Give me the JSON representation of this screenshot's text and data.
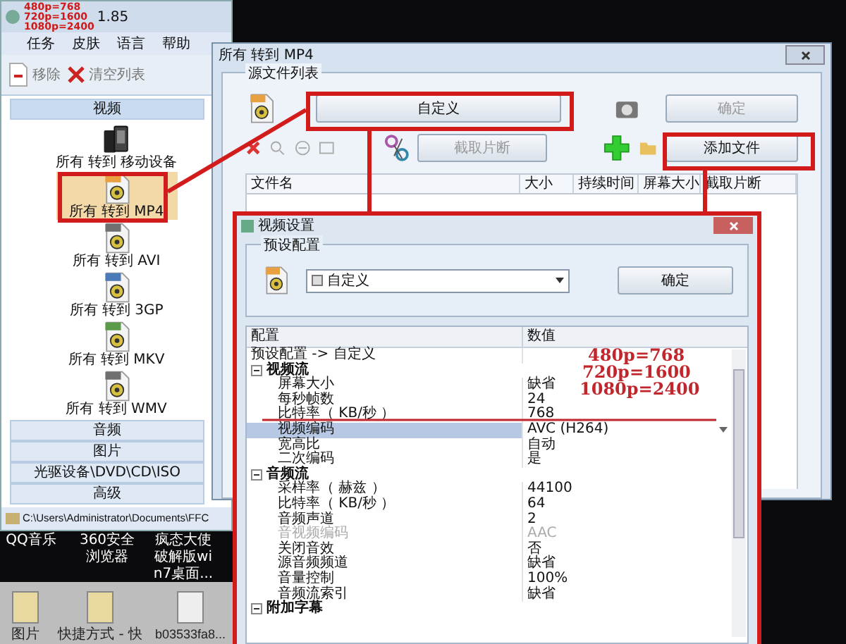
{
  "main_window": {
    "title": "1.85",
    "title_note": [
      "480p=768",
      "720p=1600",
      "1080p=2400"
    ],
    "menu": [
      "任务",
      "皮肤",
      "语言",
      "帮助"
    ],
    "toolbar": [
      "移除",
      "清空列表"
    ],
    "sections": [
      {
        "label": "视频",
        "expanded": true,
        "items": [
          {
            "label": "所有 转到 移动设备",
            "kind": "device",
            "selected": false
          },
          {
            "label": "所有 转到 MP4",
            "kind": "file",
            "color": "#e8a040",
            "selected": true
          },
          {
            "label": "所有 转到 AVI",
            "kind": "file",
            "color": "#707070",
            "selected": false
          },
          {
            "label": "所有 转到 3GP",
            "kind": "file",
            "color": "#4a7ab8",
            "selected": false
          },
          {
            "label": "所有 转到 MKV",
            "kind": "file",
            "color": "#5a9a48",
            "selected": false
          },
          {
            "label": "所有 转到 WMV",
            "kind": "file",
            "color": "#707070",
            "selected": false
          }
        ]
      },
      {
        "label": "音频",
        "expanded": false
      },
      {
        "label": "图片",
        "expanded": false
      },
      {
        "label": "光驱设备\\DVD\\CD\\ISO",
        "expanded": false
      },
      {
        "label": "高级",
        "expanded": false
      }
    ],
    "path": "C:\\Users\\Administrator\\Documents\\FFC"
  },
  "desktop": {
    "shortcuts": [
      {
        "label": "QQ音乐"
      },
      {
        "label": "360安全浏览器"
      },
      {
        "label": "疯态大使破解版win7桌面..."
      }
    ],
    "icons": [
      {
        "label": "图片"
      },
      {
        "label": "快捷方式 - 快"
      },
      {
        "label": "b03533fa8..."
      }
    ]
  },
  "convert_window": {
    "title": "所有 转到 MP4",
    "group": "源文件列表",
    "profile_button": "自定义",
    "ok_button": "确定",
    "clip_button": "截取片断",
    "add_button": "添加文件",
    "columns": [
      "文件名",
      "大小",
      "持续时间",
      "屏幕大小",
      "截取片断"
    ]
  },
  "video_settings": {
    "title": "视频设置",
    "group": "预设配置",
    "preset": "自定义",
    "ok_button": "确定",
    "columns": [
      "配置",
      "数值"
    ],
    "rows": [
      {
        "kind": "path",
        "label": "预设配置 -> 自定义"
      },
      {
        "kind": "category",
        "label": "视频流",
        "expanded": true
      },
      {
        "kind": "property",
        "label": "屏幕大小",
        "value": "缺省",
        "selected": false,
        "disabled": false
      },
      {
        "kind": "property",
        "label": "每秒帧数",
        "value": "24",
        "selected": false,
        "disabled": false
      },
      {
        "kind": "property",
        "label": "比特率（ KB/秒 ）",
        "value": "768",
        "selected": false,
        "disabled": false
      },
      {
        "kind": "property",
        "label": "视频编码",
        "value": "AVC (H264)",
        "selected": true,
        "disabled": false
      },
      {
        "kind": "property",
        "label": "宽高比",
        "value": "自动",
        "selected": false,
        "disabled": false
      },
      {
        "kind": "property",
        "label": "二次编码",
        "value": "是",
        "selected": false,
        "disabled": false
      },
      {
        "kind": "category",
        "label": "音频流",
        "expanded": true
      },
      {
        "kind": "property",
        "label": "采样率（ 赫兹 ）",
        "value": "44100",
        "selected": false,
        "disabled": false
      },
      {
        "kind": "property",
        "label": "比特率（ KB/秒 ）",
        "value": "64",
        "selected": false,
        "disabled": false
      },
      {
        "kind": "property",
        "label": "音频声道",
        "value": "2",
        "selected": false,
        "disabled": false
      },
      {
        "kind": "property",
        "label": "音视频编码",
        "value": "AAC",
        "selected": false,
        "disabled": true
      },
      {
        "kind": "property",
        "label": "关闭音效",
        "value": "否",
        "selected": false,
        "disabled": false
      },
      {
        "kind": "property",
        "label": "源音频频道",
        "value": "缺省",
        "selected": false,
        "disabled": false
      },
      {
        "kind": "property",
        "label": "音量控制",
        "value": "100%",
        "selected": false,
        "disabled": false
      },
      {
        "kind": "property",
        "label": "音频流索引",
        "value": "缺省",
        "selected": false,
        "disabled": false
      },
      {
        "kind": "category",
        "label": "附加字幕",
        "expanded": true
      }
    ]
  },
  "annotations": [
    "480p=768",
    "720p=1600",
    "1080p=2400"
  ]
}
